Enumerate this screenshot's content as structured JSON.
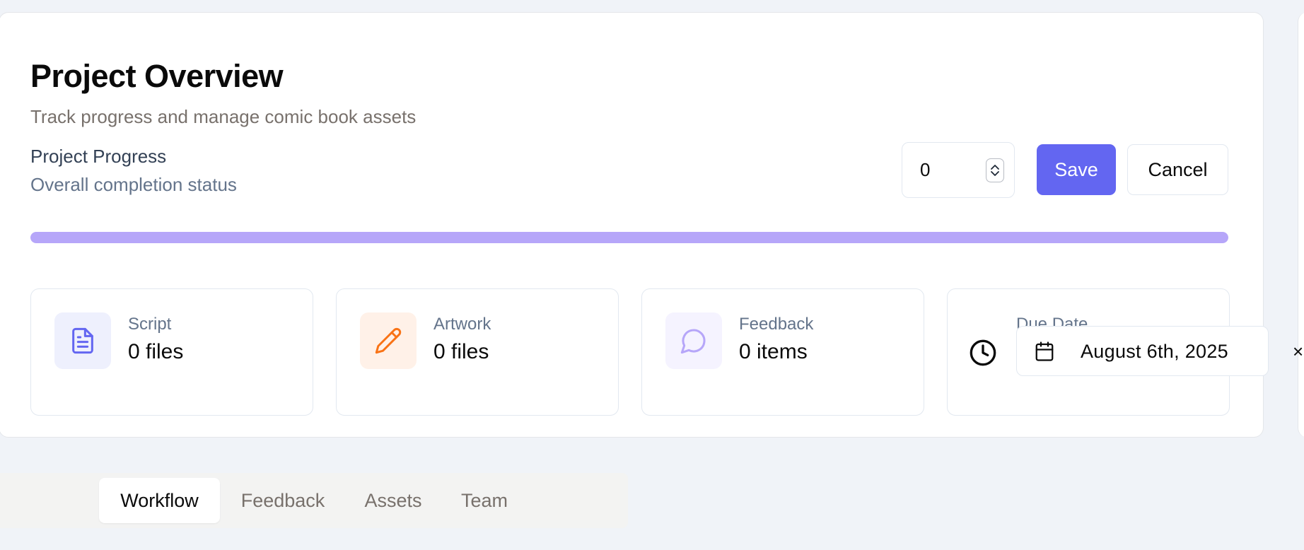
{
  "header": {
    "title": "Project Overview",
    "subtitle": "Track progress and manage comic book assets"
  },
  "progress": {
    "title": "Project Progress",
    "description": "Overall completion status",
    "input_value": "0",
    "fill_fraction": 1.0,
    "fill_color": "#b6a6f9",
    "track_color": "#e9e5fb"
  },
  "actions": {
    "save_label": "Save",
    "cancel_label": "Cancel",
    "accent_color": "#6366f1"
  },
  "stats": [
    {
      "label": "Script",
      "value": "0 files",
      "icon": "file-text-icon",
      "icon_color": "#6366f1",
      "icon_bg": "#eef0fd"
    },
    {
      "label": "Artwork",
      "value": "0 files",
      "icon": "pencil-icon",
      "icon_color": "#f97316",
      "icon_bg": "#fff1e8"
    },
    {
      "label": "Feedback",
      "value": "0 items",
      "icon": "message-circle-icon",
      "icon_color": "#b6a6f9",
      "icon_bg": "#f5f3ff"
    },
    {
      "label": "Due Date",
      "icon": "clock-icon"
    }
  ],
  "due_date": {
    "value": "August 6th, 2025",
    "icon": "calendar-icon"
  },
  "edge_glyph": "×",
  "tabs": [
    {
      "label": "Workflow",
      "active": true
    },
    {
      "label": "Feedback",
      "active": false
    },
    {
      "label": "Assets",
      "active": false
    },
    {
      "label": "Team",
      "active": false
    }
  ]
}
